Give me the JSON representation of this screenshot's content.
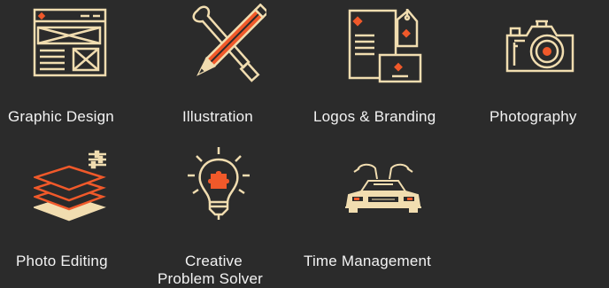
{
  "skills": [
    {
      "label": "Graphic Design",
      "icon": "wireframe-layout-icon"
    },
    {
      "label": "Illustration",
      "icon": "pencil-brush-cross-icon"
    },
    {
      "label": "Logos & Branding",
      "icon": "branding-stationery-icon"
    },
    {
      "label": "Photography",
      "icon": "camera-icon"
    },
    {
      "label": "Photo Editing",
      "icon": "layers-sliders-icon"
    },
    {
      "label": "Creative",
      "label_line2": "Problem Solver",
      "icon": "lightbulb-puzzle-icon"
    },
    {
      "label": "Time Management",
      "icon": "delorean-car-icon"
    }
  ],
  "colors": {
    "background": "#2b2b2b",
    "line": "#f1ddb0",
    "accent": "#f0592a",
    "text": "#f3f3f3"
  }
}
